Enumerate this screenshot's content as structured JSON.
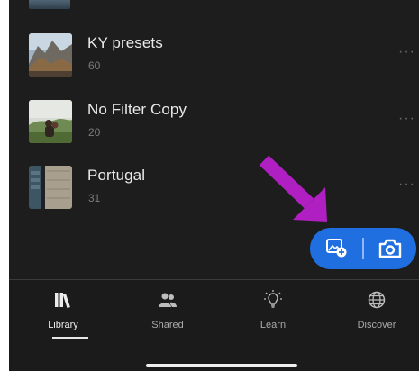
{
  "albums": [
    {
      "title": "KY presets",
      "count": "60",
      "more": "···"
    },
    {
      "title": "No Filter Copy",
      "count": "20",
      "more": "···"
    },
    {
      "title": "Portugal",
      "count": "31",
      "more": "···"
    }
  ],
  "fab": {
    "add_icon": "add-photo-icon",
    "camera_icon": "camera-icon"
  },
  "tabs": [
    {
      "label": "Library",
      "icon": "library-icon",
      "active": true
    },
    {
      "label": "Shared",
      "icon": "people-icon",
      "active": false
    },
    {
      "label": "Learn",
      "icon": "lightbulb-icon",
      "active": false
    },
    {
      "label": "Discover",
      "icon": "globe-icon",
      "active": false
    }
  ],
  "colors": {
    "accent": "#1f6fe0",
    "arrow": "#b01fc2",
    "background": "#1d1d1d"
  }
}
